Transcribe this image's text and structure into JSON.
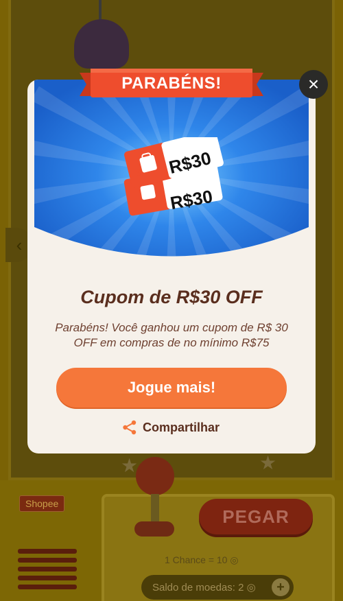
{
  "background": {
    "logo": "Shopee",
    "grab_button": "PEGAR",
    "chance_text": "1 Chance = 10",
    "coins_text": "Saldo de moedas: 2",
    "plus_label": "+",
    "prev_arrow": "‹"
  },
  "modal": {
    "ribbon_title": "PARABÉNS!",
    "coupon_amount_1": "R$30",
    "coupon_amount_2": "R$30",
    "coupon_title": "Cupom de R$30 OFF",
    "description": "Parabéns! Você ganhou um cupom de R$ 30 OFF em compras de no mínimo R$75",
    "play_button": "Jogue mais!",
    "share_label": "Compartilhar",
    "close_label": "×"
  },
  "colors": {
    "hero_blue": "#1f6fd6",
    "ribbon_red": "#ee4d2d",
    "button_orange": "#f5773a",
    "title_brown": "#5a2e1e",
    "card_bg": "#f6f1ea"
  },
  "icons": {
    "close": "close-icon",
    "share": "share-icon",
    "shopee_bag": "shopee-bag-icon",
    "coin": "coin-icon"
  }
}
